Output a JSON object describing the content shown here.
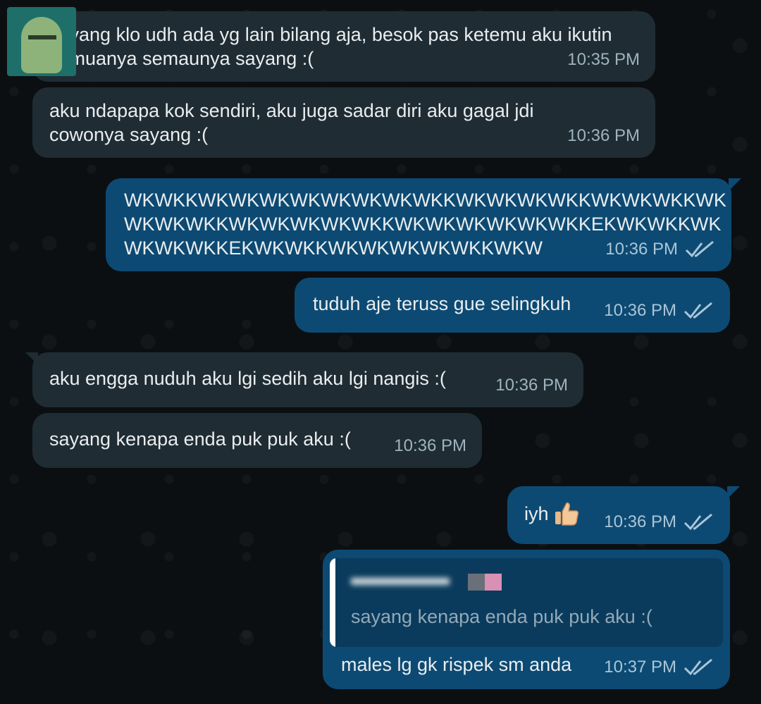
{
  "messages": [
    {
      "dir": "in",
      "text": "sayang klo udh ada yg lain bilang aja, besok pas ketemu aku ikutin semuanya semaunya sayang :(",
      "time": "10:35 PM"
    },
    {
      "dir": "in",
      "text": "aku ndapapa kok sendiri, aku juga sadar diri aku gagal jdi cowonya sayang :(",
      "time": "10:36 PM"
    },
    {
      "dir": "out",
      "text_lines": [
        "WKWKKWKWKWKWKWKWKWKWKKWKWKWKWKKWKWKWKKWK",
        "WKWKWKKWKWKWKWKWKKWKWKWKWKWKWKKEKWKWKKWK",
        "WKWKWKKEKWKWKKWKWKWKWKWKKWKW"
      ],
      "time": "10:36 PM",
      "status": "read"
    },
    {
      "dir": "out",
      "text": "tuduh aje teruss gue selingkuh",
      "time": "10:36 PM",
      "status": "read"
    },
    {
      "dir": "in",
      "text": "aku engga nuduh aku lgi sedih aku lgi nangis :(",
      "time": "10:36 PM"
    },
    {
      "dir": "in",
      "text": "sayang kenapa enda puk puk aku :(",
      "time": "10:36 PM"
    },
    {
      "dir": "out",
      "text": "iyh",
      "emoji": "thumbs-up",
      "time": "10:36 PM",
      "status": "read"
    },
    {
      "dir": "out",
      "quoted_text": "sayang kenapa enda puk puk aku :(",
      "text": "males lg gk rispek sm anda",
      "time": "10:37 PM",
      "status": "read"
    }
  ],
  "colors": {
    "incoming_bubble": "#1f2c33",
    "outgoing_bubble": "#0d4a73",
    "quote_bar": "#ffffff",
    "background": "#0b0f12"
  },
  "icons": {
    "read_ticks": "double-check-icon",
    "emoji": "thumbs-up-icon",
    "avatar": "sticker-avatar"
  }
}
